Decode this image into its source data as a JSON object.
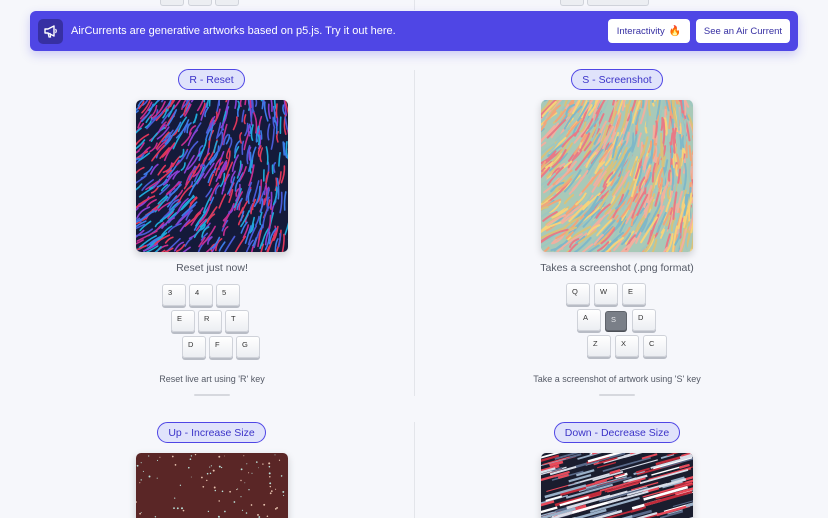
{
  "banner": {
    "message": "AirCurrents are generative artworks based on p5.js. Try it out here.",
    "interactivity_label": "Interactivity",
    "interactivity_emoji": "🔥",
    "see_label": "See an Air Current",
    "icon": "megaphone-icon"
  },
  "cards": [
    {
      "pill": "R - Reset",
      "caption": "Reset just now!",
      "keys": [
        "3",
        "4",
        "5",
        "E",
        "R",
        "T",
        "D",
        "F",
        "G"
      ],
      "hint": "Reset live art using 'R' key"
    },
    {
      "pill": "S - Screenshot",
      "caption": "Takes a screenshot (.png format)",
      "keys": [
        "Q",
        "W",
        "E",
        "A",
        "S",
        "D",
        "Z",
        "X",
        "C"
      ],
      "active_key": "S",
      "hint": "Take a screenshot of artwork using 'S' key"
    },
    {
      "pill": "Up - Increase Size"
    },
    {
      "pill": "Down - Decrease Size"
    }
  ],
  "colors": {
    "accent": "#4f46e5",
    "pill_bg": "#e0e3fb",
    "page_bg": "#f6f7fb"
  }
}
